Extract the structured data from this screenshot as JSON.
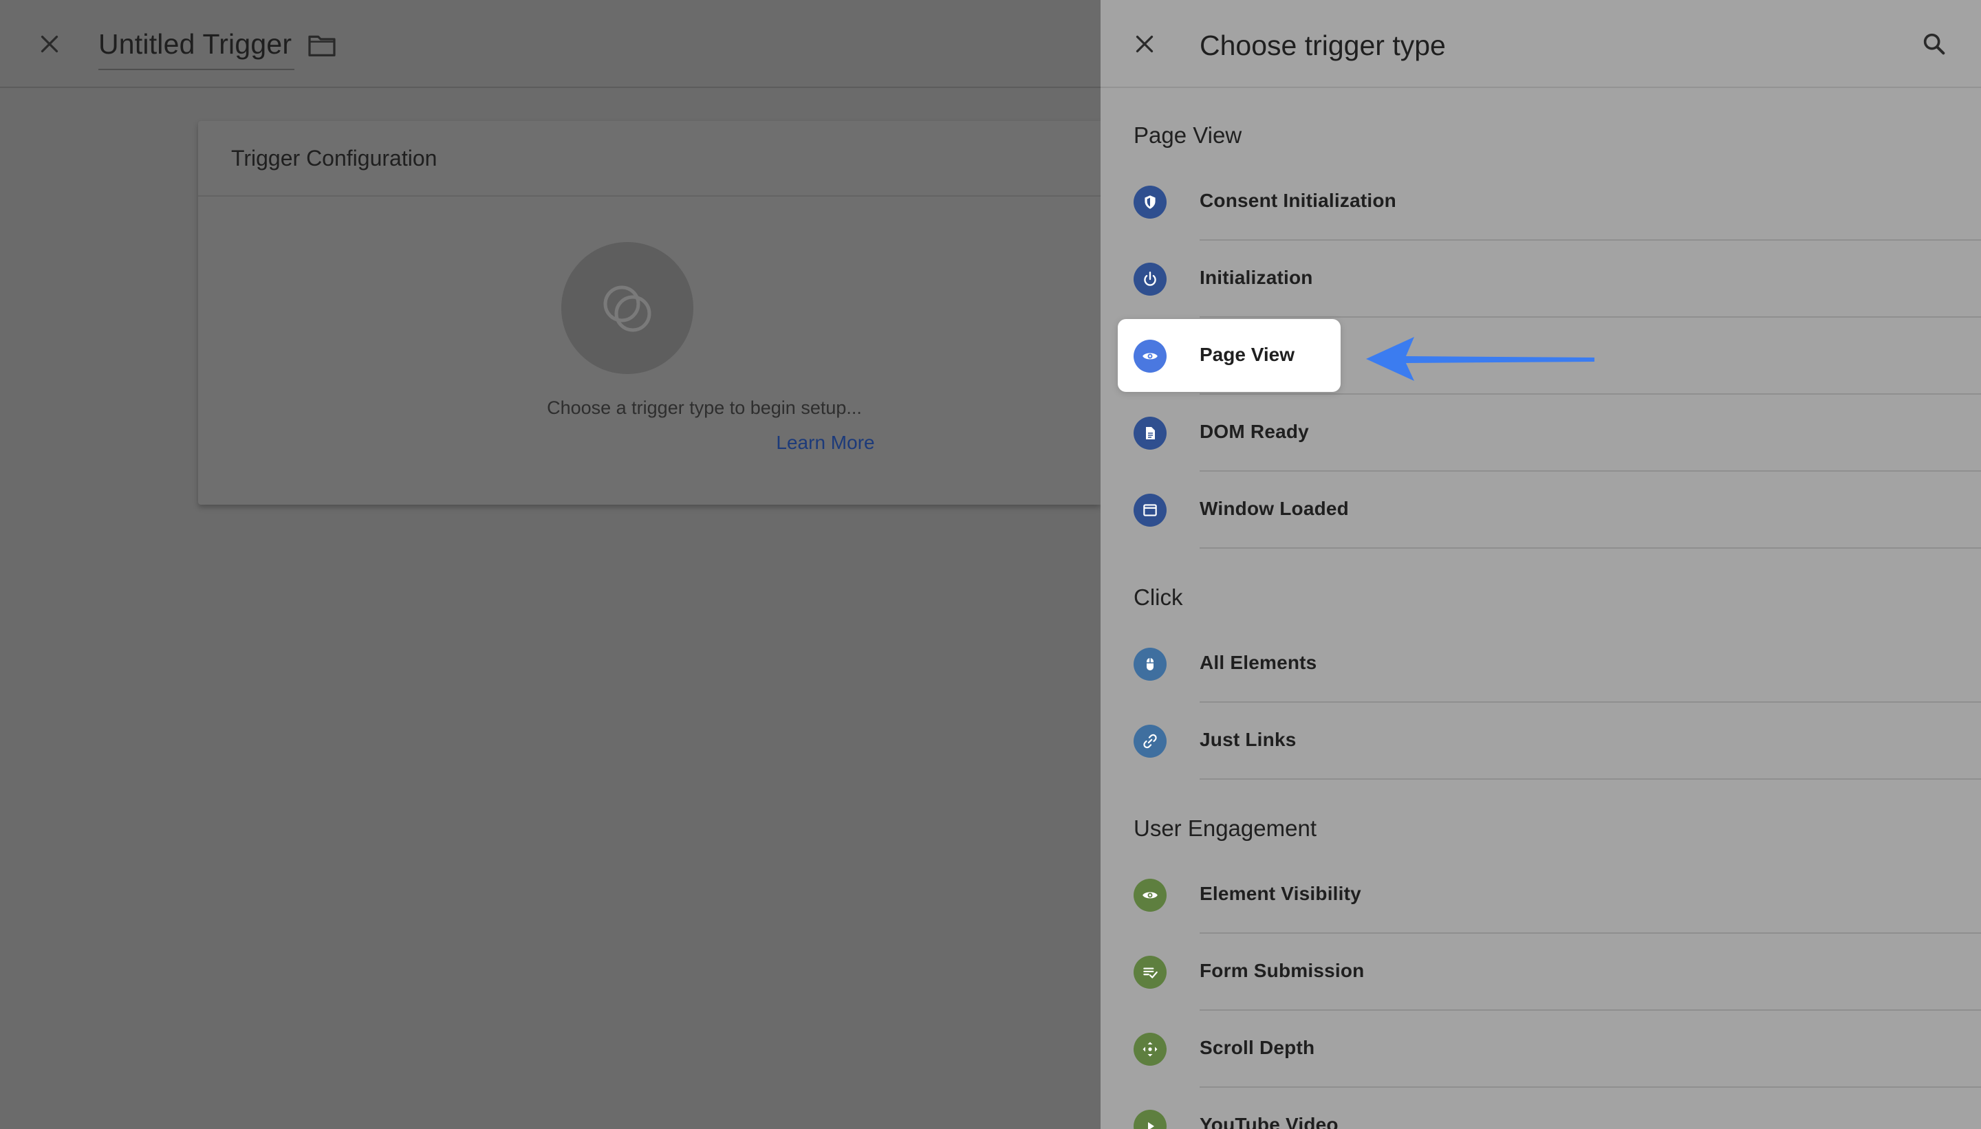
{
  "editor": {
    "title": "Untitled Trigger",
    "card": {
      "title": "Trigger Configuration",
      "message": "Choose a trigger type to begin setup...",
      "learn_more": "Learn More"
    }
  },
  "panel": {
    "title": "Choose trigger type",
    "sections": [
      {
        "title": "Page View",
        "items": [
          {
            "label": "Consent Initialization",
            "icon": "shield-icon"
          },
          {
            "label": "Initialization",
            "icon": "power-icon"
          },
          {
            "label": "Page View",
            "icon": "eye-icon",
            "highlighted": true
          },
          {
            "label": "DOM Ready",
            "icon": "document-icon"
          },
          {
            "label": "Window Loaded",
            "icon": "browser-window-icon"
          }
        ]
      },
      {
        "title": "Click",
        "items": [
          {
            "label": "All Elements",
            "icon": "mouse-icon"
          },
          {
            "label": "Just Links",
            "icon": "link-icon"
          }
        ]
      },
      {
        "title": "User Engagement",
        "items": [
          {
            "label": "Element Visibility",
            "icon": "eye-icon"
          },
          {
            "label": "Form Submission",
            "icon": "form-check-icon"
          },
          {
            "label": "Scroll Depth",
            "icon": "scroll-move-icon"
          },
          {
            "label": "YouTube Video",
            "icon": "play-icon"
          }
        ]
      }
    ]
  },
  "colors": {
    "overlay": "#6b6b6b",
    "panel_dimmed": "#a3a3a3",
    "page_view_group": "#2f4f8f",
    "click_group": "#3f6f9f",
    "engagement_group": "#5e7f3f",
    "highlight_icon": "#4a78e0",
    "annotation_arrow": "#3b7cf0",
    "link": "#1c3a7a"
  }
}
